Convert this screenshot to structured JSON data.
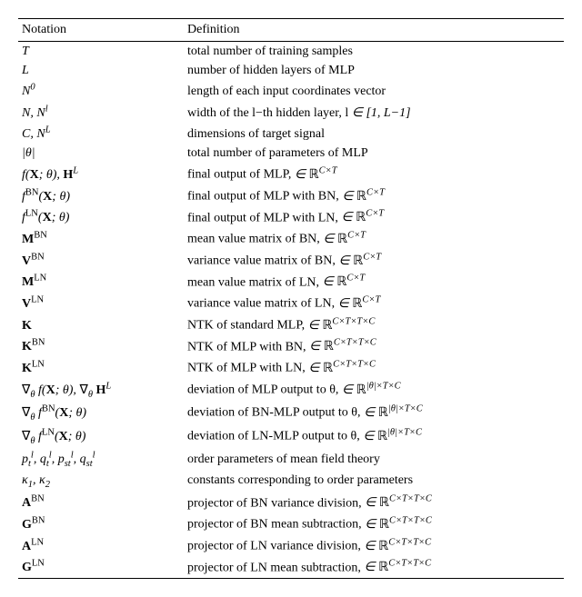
{
  "headers": {
    "notation": "Notation",
    "definition": "Definition"
  },
  "rows": [
    {
      "n": "T",
      "d": "total number of training samples"
    },
    {
      "n": "L",
      "d": "number of hidden layers of MLP"
    },
    {
      "n": "N^{0}",
      "d": "length of each input coordinates vector"
    },
    {
      "n": "N, N^{l}",
      "d": "width of the l−th hidden layer, l ∈ [1, L−1]"
    },
    {
      "n": "C, N^{L}",
      "d": "dimensions of target signal"
    },
    {
      "n": "|θ|",
      "d": "total number of parameters of MLP"
    },
    {
      "n": "f(X; θ), H^{L}",
      "d": "final output of MLP, ∈ ℝ^{C×T}"
    },
    {
      "n": "f^{BN}(X; θ)",
      "d": "final output of MLP with BN, ∈ ℝ^{C×T}"
    },
    {
      "n": "f^{LN}(X; θ)",
      "d": "final output of MLP with LN, ∈ ℝ^{C×T}"
    },
    {
      "n": "M^{BN}",
      "d": "mean value matrix of BN, ∈ ℝ^{C×T}"
    },
    {
      "n": "V^{BN}",
      "d": "variance value matrix of BN, ∈ ℝ^{C×T}"
    },
    {
      "n": "M^{LN}",
      "d": "mean value matrix of LN, ∈ ℝ^{C×T}"
    },
    {
      "n": "V^{LN}",
      "d": "variance value matrix of LN, ∈ ℝ^{C×T}"
    },
    {
      "n": "K",
      "d": "NTK of standard MLP, ∈ ℝ^{C×T×T×C}"
    },
    {
      "n": "K^{BN}",
      "d": "NTK of MLP with BN, ∈ ℝ^{C×T×T×C}"
    },
    {
      "n": "K^{LN}",
      "d": "NTK of MLP with LN, ∈ ℝ^{C×T×T×C}"
    },
    {
      "n": "∇_{θ} f(X; θ), ∇_{θ} H^{L}",
      "d": "deviation of MLP output to θ, ∈ ℝ^{|θ|×T×C}"
    },
    {
      "n": "∇_{θ} f^{BN}(X; θ)",
      "d": "deviation of BN-MLP output to θ, ∈ ℝ^{|θ|×T×C}"
    },
    {
      "n": "∇_{θ} f^{LN}(X; θ)",
      "d": "deviation of LN-MLP output to θ, ∈ ℝ^{|θ|×T×C}"
    },
    {
      "n": "p_{t}^{l}, q_{t}^{l}, p_{st}^{l}, q_{st}^{l}",
      "d": "order parameters of mean field theory"
    },
    {
      "n": "κ_{1}, κ_{2}",
      "d": "constants corresponding to order parameters"
    },
    {
      "n": "A^{BN}",
      "d": "projector of BN variance division, ∈ ℝ^{C×T×T×C}"
    },
    {
      "n": "G^{BN}",
      "d": "projector of BN mean subtraction, ∈ ℝ^{C×T×T×C}"
    },
    {
      "n": "A^{LN}",
      "d": "projector of LN variance division, ∈ ℝ^{C×T×T×C}"
    },
    {
      "n": "G^{LN}",
      "d": "projector of LN mean subtraction, ∈ ℝ^{C×T×T×C}"
    }
  ],
  "chart_data": {
    "type": "table",
    "title": "Notation Definitions",
    "columns": [
      "Notation",
      "Definition"
    ],
    "rows": [
      [
        "T",
        "total number of training samples"
      ],
      [
        "L",
        "number of hidden layers of MLP"
      ],
      [
        "N^0",
        "length of each input coordinates vector"
      ],
      [
        "N, N^l",
        "width of the l-th hidden layer, l ∈ [1, L−1]"
      ],
      [
        "C, N^L",
        "dimensions of target signal"
      ],
      [
        "|θ|",
        "total number of parameters of MLP"
      ],
      [
        "f(X; θ), H^L",
        "final output of MLP, ∈ ℝ^{C×T}"
      ],
      [
        "f^{BN}(X; θ)",
        "final output of MLP with BN, ∈ ℝ^{C×T}"
      ],
      [
        "f^{LN}(X; θ)",
        "final output of MLP with LN, ∈ ℝ^{C×T}"
      ],
      [
        "M^{BN}",
        "mean value matrix of BN, ∈ ℝ^{C×T}"
      ],
      [
        "V^{BN}",
        "variance value matrix of BN, ∈ ℝ^{C×T}"
      ],
      [
        "M^{LN}",
        "mean value matrix of LN, ∈ ℝ^{C×T}"
      ],
      [
        "V^{LN}",
        "variance value matrix of LN, ∈ ℝ^{C×T}"
      ],
      [
        "K",
        "NTK of standard MLP, ∈ ℝ^{C×T×T×C}"
      ],
      [
        "K^{BN}",
        "NTK of MLP with BN, ∈ ℝ^{C×T×T×C}"
      ],
      [
        "K^{LN}",
        "NTK of MLP with LN, ∈ ℝ^{C×T×T×C}"
      ],
      [
        "∇_θ f(X; θ), ∇_θ H^L",
        "deviation of MLP output to θ, ∈ ℝ^{|θ|×T×C}"
      ],
      [
        "∇_θ f^{BN}(X; θ)",
        "deviation of BN-MLP output to θ, ∈ ℝ^{|θ|×T×C}"
      ],
      [
        "∇_θ f^{LN}(X; θ)",
        "deviation of LN-MLP output to θ, ∈ ℝ^{|θ|×T×C}"
      ],
      [
        "p_t^l, q_t^l, p_{st}^l, q_{st}^l",
        "order parameters of mean field theory"
      ],
      [
        "κ_1, κ_2",
        "constants corresponding to order parameters"
      ],
      [
        "A^{BN}",
        "projector of BN variance division, ∈ ℝ^{C×T×T×C}"
      ],
      [
        "G^{BN}",
        "projector of BN mean subtraction, ∈ ℝ^{C×T×T×C}"
      ],
      [
        "A^{LN}",
        "projector of LN variance division, ∈ ℝ^{C×T×T×C}"
      ],
      [
        "G^{LN}",
        "projector of LN mean subtraction, ∈ ℝ^{C×T×T×C}"
      ]
    ]
  }
}
